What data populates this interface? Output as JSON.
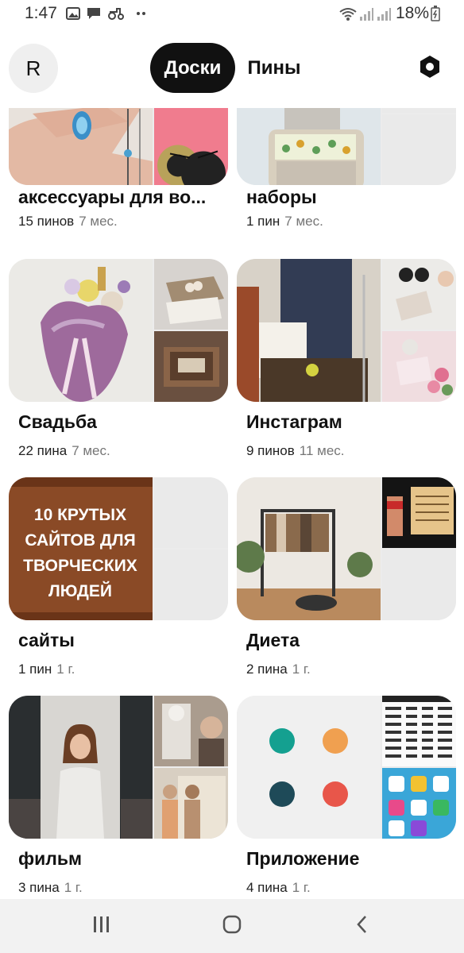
{
  "status_bar": {
    "time": "1:47",
    "battery": "18%"
  },
  "header": {
    "avatar_letter": "R",
    "tab_boards": "Доски",
    "tab_pins": "Пины"
  },
  "boards": [
    {
      "title": "аксессуары для во...",
      "pins": "15 пинов",
      "age": "7 мес."
    },
    {
      "title": "наборы",
      "pins": "1 пин",
      "age": "7 мес."
    },
    {
      "title": "Свадьба",
      "pins": "22 пина",
      "age": "7 мес."
    },
    {
      "title": "Инстаграм",
      "pins": "9 пинов",
      "age": "11 мес."
    },
    {
      "title": "сайты",
      "pins": "1 пин",
      "age": "1 г."
    },
    {
      "title": "Диета",
      "pins": "2 пина",
      "age": "1 г."
    },
    {
      "title": "фильм",
      "pins": "3 пина",
      "age": "1 г."
    },
    {
      "title": "Приложение",
      "pins": "4 пина",
      "age": "1 г."
    }
  ],
  "poster_text": [
    "10 КРУТЫХ",
    "САЙТОВ ДЛЯ",
    "ТВОРЧЕСКИХ",
    "ЛЮДЕЙ"
  ],
  "colors": {
    "tab_active_bg": "#111111",
    "card_placeholder": "#eaeaea",
    "meta_age": "#767676"
  },
  "icons": [
    "image-icon",
    "message-icon",
    "tractor-icon",
    "wifi-icon",
    "signal-icon",
    "battery-icon",
    "settings-hexagon-icon",
    "recent-apps-icon",
    "home-icon",
    "back-icon"
  ]
}
